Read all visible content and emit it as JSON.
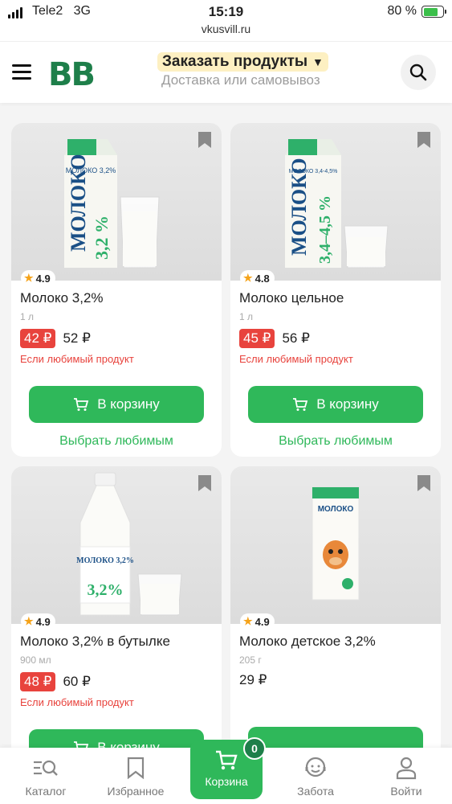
{
  "status": {
    "carrier": "Tele2",
    "network": "3G",
    "time": "15:19",
    "battery": "80 %"
  },
  "url": "vkusvill.ru",
  "header": {
    "logo": "ВВ",
    "order_title": "Заказать продукты",
    "order_subtitle": "Доставка или самовывоз"
  },
  "products": [
    {
      "rating": "4.9",
      "name": "Молоко 3,2%",
      "unit": "1 л",
      "sale_price": "42 ₽",
      "price": "52 ₽",
      "note": "Если любимый продукт",
      "cart_label": "В корзину",
      "choose_label": "Выбрать любимым",
      "package_text": "МОЛОКО 3,2%"
    },
    {
      "rating": "4.8",
      "name": "Молоко цельное",
      "unit": "1 л",
      "sale_price": "45 ₽",
      "price": "56 ₽",
      "note": "Если любимый продукт",
      "cart_label": "В корзину",
      "choose_label": "Выбрать любимым",
      "package_text": "МОЛОКО 3,4-4,5%"
    },
    {
      "rating": "4.9",
      "name": "Молоко 3,2% в бутылке",
      "unit": "900 мл",
      "sale_price": "48 ₽",
      "price": "60 ₽",
      "note": "Если любимый продукт",
      "cart_label": "В корзину",
      "package_text": "МОЛОКО 3,2%"
    },
    {
      "rating": "4.9",
      "name": "Молоко детское 3,2%",
      "unit": "205 г",
      "price": "29 ₽",
      "package_text": "МОЛОКО"
    }
  ],
  "tabbar": {
    "catalog": "Каталог",
    "favorites": "Избранное",
    "cart": "Корзина",
    "cart_count": "0",
    "care": "Забота",
    "login": "Войти"
  },
  "colors": {
    "brand_green": "#2fb85a",
    "logo_green": "#1e7f4a",
    "sale_red": "#e8433d"
  }
}
